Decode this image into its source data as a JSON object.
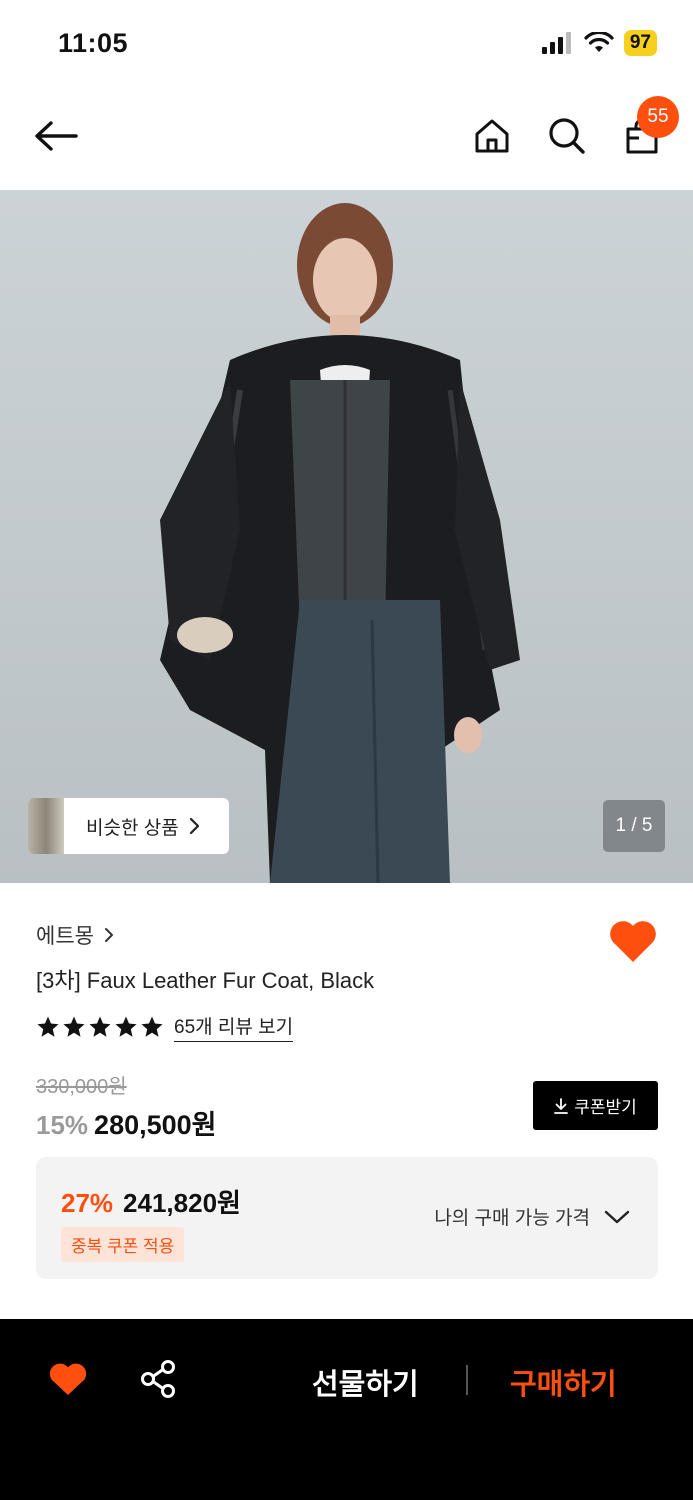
{
  "status_bar": {
    "time": "11:05",
    "battery": "97"
  },
  "nav": {
    "cart_count": "55"
  },
  "gallery": {
    "similar_label": "비슷한 상품",
    "counter": "1 / 5"
  },
  "product": {
    "brand": "에트몽",
    "title": "[3차] Faux Leather Fur Coat, Black",
    "rating_stars": 5,
    "review_link": "65개 리뷰 보기",
    "original_price": "330,000원",
    "discount": "15%",
    "price": "280,500원",
    "coupon_button": "쿠폰받기"
  },
  "my_price": {
    "discount": "27%",
    "price": "241,820원",
    "badge": "중복 쿠폰 적용",
    "label": "나의 구매 가능 가격"
  },
  "bottom_bar": {
    "gift_label": "선물하기",
    "buy_label": "구매하기"
  },
  "colors": {
    "accent": "#ff4f0f",
    "battery": "#f7cf1d",
    "bottom_bar": "#000000"
  },
  "icons": [
    "back-arrow-icon",
    "home-icon",
    "search-icon",
    "shopping-bag-icon",
    "heart-icon",
    "star-icon",
    "chevron-right-icon",
    "download-icon",
    "chevron-down-icon",
    "share-icon",
    "signal-icon",
    "wifi-icon"
  ]
}
